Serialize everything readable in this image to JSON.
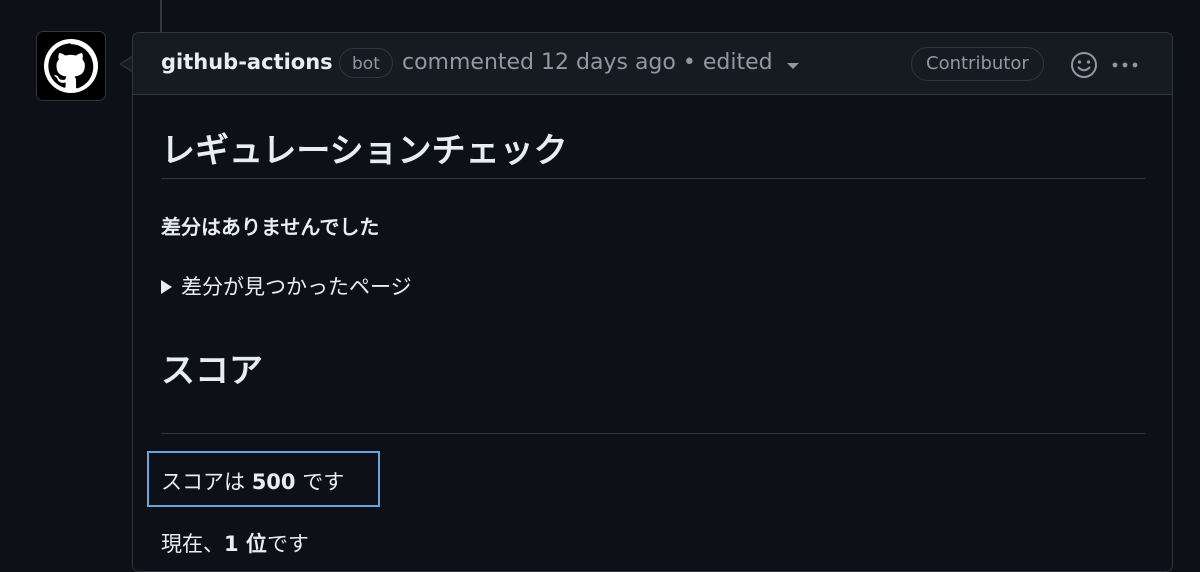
{
  "comment": {
    "author": "github-actions",
    "bot_badge": "bot",
    "action": "commented",
    "time": "12 days ago",
    "separator": "•",
    "edited": "edited",
    "role_badge": "Contributor",
    "avatar_icon": "github-octocat-icon",
    "emoji_icon": "smiley-icon",
    "more_icon": "kebab-horizontal-icon"
  },
  "body": {
    "heading1": "レギュレーションチェック",
    "no_diff": "差分はありませんでした",
    "details_summary": "差分が見つかったページ",
    "heading2": "スコア",
    "score_prefix": "スコアは ",
    "score_value": "500",
    "score_suffix": " です",
    "rank_prefix": "現在、",
    "rank_value": "1 位",
    "rank_suffix": "です"
  },
  "colors": {
    "background": "#0d1117",
    "header_bg": "#161b22",
    "border": "#30363d",
    "text": "#e6edf3",
    "muted": "#9198a1",
    "highlight": "#79c0ff"
  }
}
